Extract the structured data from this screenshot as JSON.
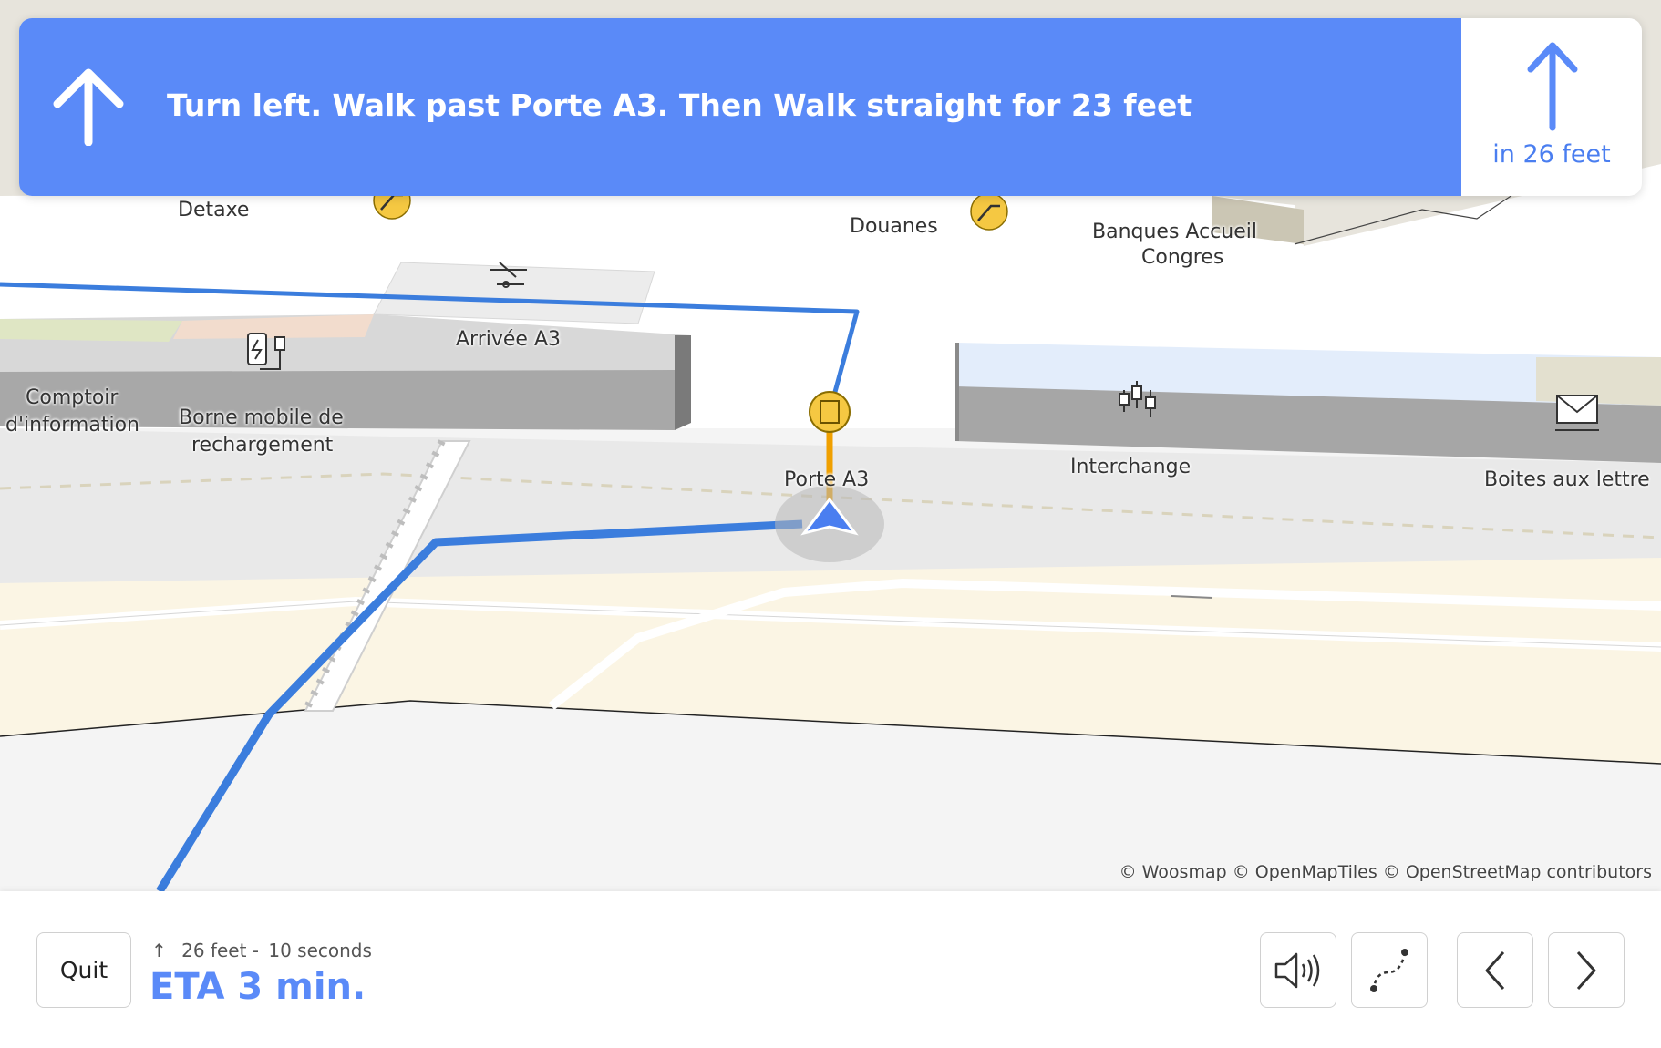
{
  "colors": {
    "accent": "#5a8af8",
    "route": "#3b7ddd",
    "route_active": "#f0a000"
  },
  "banner": {
    "instruction": "Turn left. Walk past Porte A3. Then Walk straight for 23 feet",
    "instruction_icon": "arrow-up-icon",
    "next_distance": "in 26 feet",
    "next_icon": "arrow-up-icon"
  },
  "map": {
    "labels": {
      "detaxe": "Detaxe",
      "douanes": "Douanes",
      "banques": "Banques Accueil",
      "congres": "Congres",
      "arrivee": "Arrivée A3",
      "comptoir1": "Comptoir",
      "comptoir2": "d'information",
      "borne1": "Borne mobile de",
      "borne2": "rechargement",
      "porte": "Porte A3",
      "interchange": "Interchange",
      "boites": "Boites aux lettre"
    },
    "attribution": "© Woosmap © OpenMapTiles © OpenStreetMap contributors"
  },
  "footer": {
    "quit_label": "Quit",
    "step_arrow": "↑",
    "step_distance": "26 feet -",
    "step_time": "10 seconds",
    "eta": "ETA 3 min."
  }
}
